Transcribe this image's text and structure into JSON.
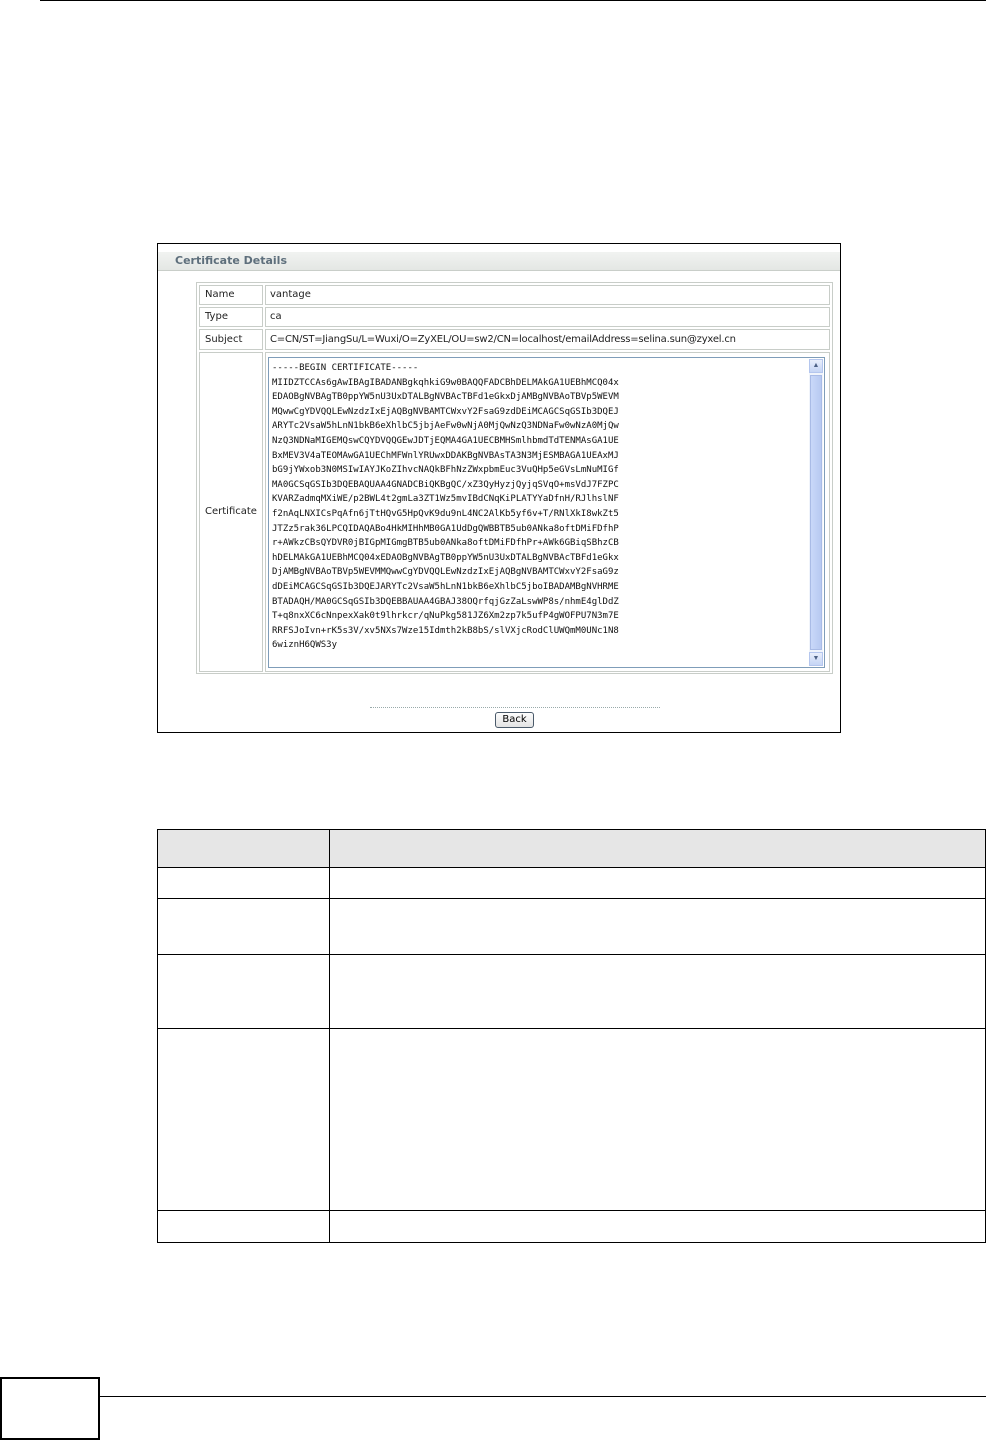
{
  "panel": {
    "title": "Certificate Details",
    "rows": [
      {
        "label": "Name",
        "value": "vantage"
      },
      {
        "label": "Type",
        "value": "ca"
      },
      {
        "label": "Subject",
        "value": "C=CN/ST=JiangSu/L=Wuxi/O=ZyXEL/OU=sw2/CN=localhost/emailAddress=selina.sun@zyxel.cn"
      }
    ],
    "certificate_label": "Certificate",
    "certificate_text": "-----BEGIN CERTIFICATE-----\nMIIDZTCCAs6gAwIBAgIBADANBgkqhkiG9w0BAQQFADCBhDELMAkGA1UEBhMCQ04x\nEDAOBgNVBAgTB0ppYW5nU3UxDTALBgNVBAcTBFd1eGkxDjAMBgNVBAoTBVp5WEVM\nMQwwCgYDVQQLEwNzdzIxEjAQBgNVBAMTCWxvY2FsaG9zdDEiMCAGCSqGSIb3DQEJ\nARYTc2VsaW5hLnN1bkB6eXhlbC5jbjAeFw0wNjA0MjQwNzQ3NDNaFw0wNzA0MjQw\nNzQ3NDNaMIGEMQswCQYDVQQGEwJDTjEQMA4GA1UECBMHSmlhbmdTdTENMAsGA1UE\nBxMEV3V4aTEOMAwGA1UEChMFWnlYRUwxDDAKBgNVBAsTA3N3MjESMBAGA1UEAxMJ\nbG9jYWxob3N0MSIwIAYJKoZIhvcNAQkBFhNzZWxpbmEuc3VuQHp5eGVsLmNuMIGf\nMA0GCSqGSIb3DQEBAQUAA4GNADCBiQKBgQC/xZ3QyHyzjQyjqSVqO+msVdJ7FZPC\nKVARZadmqMXiWE/p2BWL4t2gmLa3ZT1Wz5mvIBdCNqKiPLATYYaDfnH/RJlhslNF\nf2nAqLNXICsPqAfn6jTtHQvG5HpQvK9du9nL4NC2AlKb5yf6v+T/RNlXkI8wkZt5\nJTZz5rak36LPCQIDAQABo4HkMIHhMB0GA1UdDgQWBBTB5ub0ANka8oftDMiFDfhP\nr+AWkzCBsQYDVR0jBIGpMIGmgBTB5ub0ANka8oftDMiFDfhPr+AWk6GBiqSBhzCB\nhDELMAkGA1UEBhMCQ04xEDAOBgNVBAgTB0ppYW5nU3UxDTALBgNVBAcTBFd1eGkx\nDjAMBgNVBAoTBVp5WEVMMQwwCgYDVQQLEwNzdzIxEjAQBgNVBAMTCWxvY2FsaG9z\ndDEiMCAGCSqGSIb3DQEJARYTc2VsaW5hLnN1bkB6eXhlbC5jboIBADAMBgNVHRME\nBTADAQH/MA0GCSqGSIb3DQEBBAUAA4GBAJ38OQrfqjGzZaLswWP8s/nhmE4glDdZ\nT+q8nxXC6cNnpexXak0t9lhrkcr/qNuPkg581JZ6Xm2zp7k5ufP4gWOFPU7N3m7E\nRRFSJoIvn+rK5s3V/xv5NXs7Wze15Idmth2kB8bS/slVXjcRodClUWQmM0UNc1N8\n6wiznH6QWS3y",
    "back_label": "Back"
  },
  "table": {
    "header": [
      "",
      ""
    ],
    "rows": [
      [
        "",
        ""
      ],
      [
        "",
        ""
      ],
      [
        "",
        ""
      ],
      [
        "",
        ""
      ],
      [
        "",
        ""
      ]
    ]
  }
}
